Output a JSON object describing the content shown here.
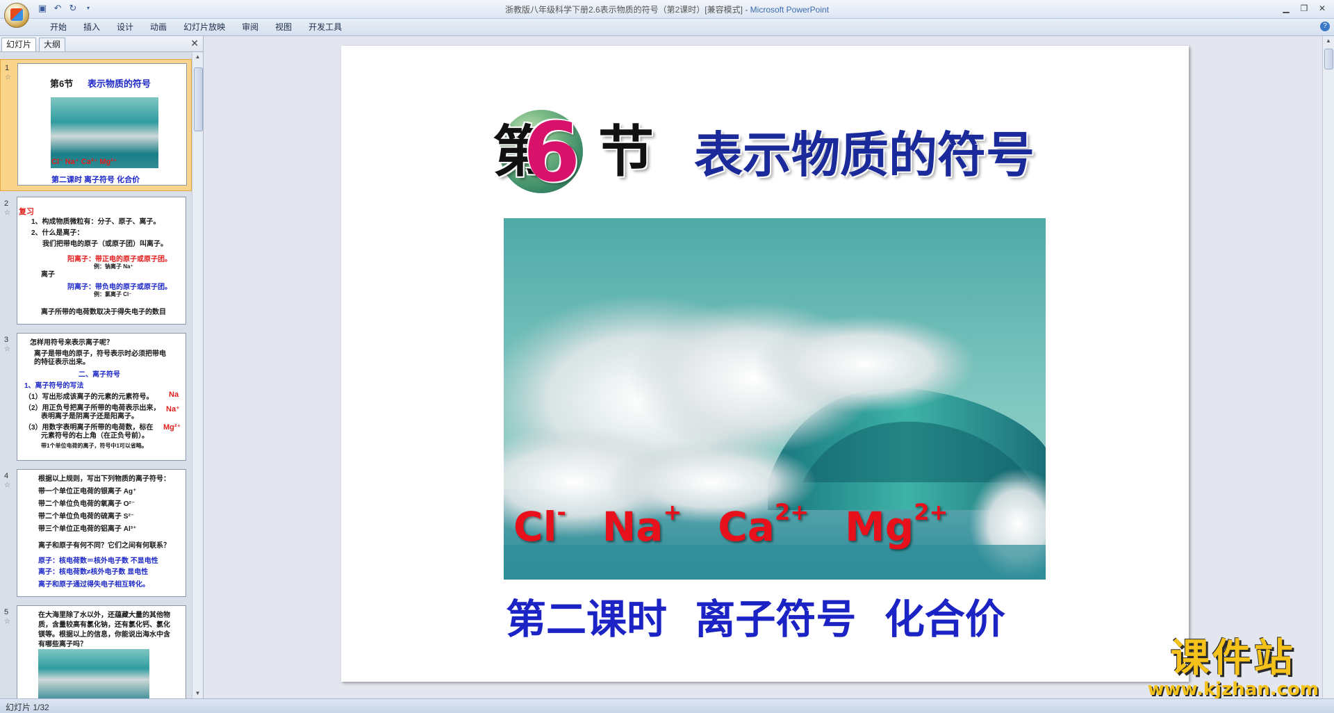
{
  "window": {
    "title": "浙教版八年级科学下册2.6表示物质的符号（第2课时）[兼容模式] - ",
    "app_name": "Microsoft PowerPoint"
  },
  "ribbon_tabs": [
    "开始",
    "插入",
    "设计",
    "动画",
    "幻灯片放映",
    "审阅",
    "视图",
    "开发工具"
  ],
  "panel": {
    "tabs": [
      "幻灯片",
      "大纲"
    ],
    "close": "✕"
  },
  "thumbnails": [
    {
      "number": "1",
      "section_label": "第6节",
      "title": "表示物质的符号",
      "ions": "Cl⁻  Na⁺  Ca²⁺  Mg²⁺",
      "subtitle": "第二课时  离子符号  化合价"
    },
    {
      "number": "2",
      "tag": "复习",
      "lines": [
        "1、构成物质微粒有：分子、原子、离子。",
        "2、什么是离子：",
        "我们把带电的原子（或原子团）叫离子。",
        "阳离子：带正电的原子或原子团。",
        "例：钠离子  Na⁺",
        "离子",
        "阴离子：带负电的原子或原子团。",
        "例：氯离子  Cl⁻",
        "离子所带的电荷数取决于得失电子的数目"
      ]
    },
    {
      "number": "3",
      "lines": [
        "怎样用符号来表示离子呢？",
        "离子是带电的原子，符号表示时必须把带电",
        "的特征表示出来。",
        "二、离子符号",
        "1、离子符号的写法",
        "（1）写出形成该离子的元素的元素符号。",
        "（2）用正负号把离子所带的电荷表示出来，",
        "表明离子是阴离子还是阳离子。",
        "（3）用数字表明离子所带的电荷数，标在",
        "元素符号的右上角（在正负号前）。",
        "带1个单位电荷的离子，符号中1可以省略。",
        "Na",
        "Na⁺",
        "Mg²⁺"
      ]
    },
    {
      "number": "4",
      "lines": [
        "根据以上规则，写出下列物质的离子符号：",
        "带一个单位正电荷的银离子 Ag⁺",
        "带二个单位负电荷的氧离子 O²⁻",
        "带二个单位负电荷的硫离子  S²⁻",
        "带三个单位正电荷的铝离子  Al³⁺",
        "离子和原子有何不同？它们之间有何联系？",
        "原子：核电荷数＝核外电子数     不显电性",
        "离子：核电荷数≠核外电子数     显电性",
        "离子和原子通过得失电子相互转化。"
      ]
    },
    {
      "number": "5",
      "lines": [
        "在大海里除了水以外，还蕴藏大量的其他物",
        "质，含量较高有氯化钠，还有氯化钙、氯化",
        "镁等。根据以上的信息，你能说出海水中含",
        "有哪些离子吗？"
      ]
    }
  ],
  "slide": {
    "section_prefix": "第",
    "section_number": "6",
    "section_suffix": "节",
    "title": "表示物质的符号",
    "ions": [
      {
        "base": "Cl",
        "charge": "-"
      },
      {
        "base": "Na",
        "charge": "+"
      },
      {
        "base": "Ca",
        "charge": "2+"
      },
      {
        "base": "Mg",
        "charge": "2+"
      }
    ],
    "subtitle_part1": "第二课时",
    "subtitle_part2": "离子符号",
    "subtitle_part3": "化合价"
  },
  "watermark": {
    "big": "课件站",
    "small": "www.kjzhan.com"
  },
  "status": {
    "slide_info": "幻灯片 1/32"
  }
}
